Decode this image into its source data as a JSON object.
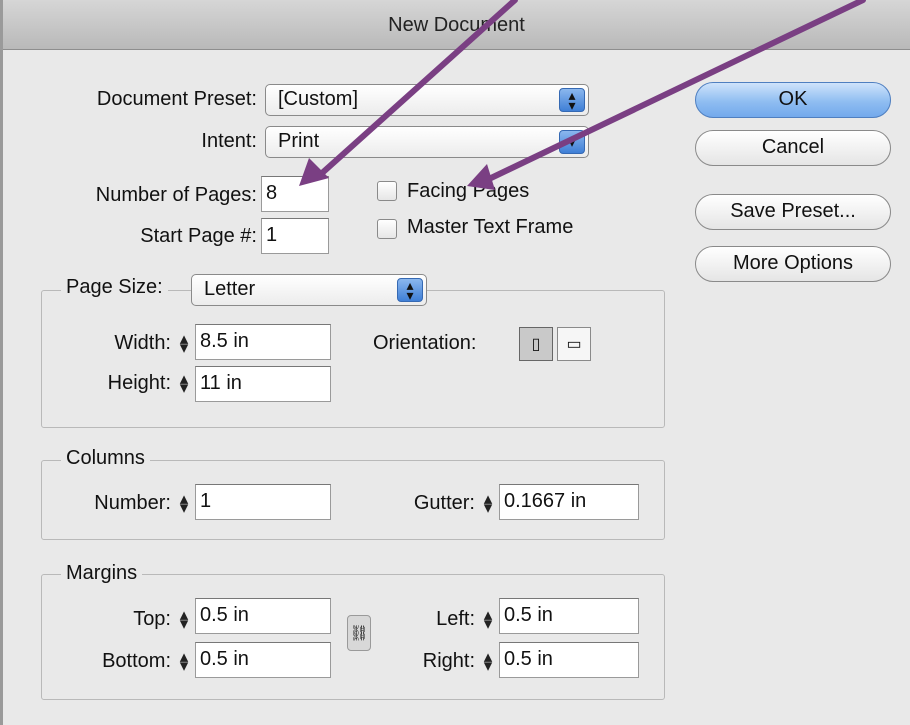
{
  "window": {
    "title": "New Document"
  },
  "top": {
    "preset_label": "Document Preset:",
    "preset_value": "[Custom]",
    "intent_label": "Intent:",
    "intent_value": "Print",
    "pages_label": "Number of Pages:",
    "pages_value": "8",
    "start_label": "Start Page #:",
    "start_value": "1",
    "facing_label": "Facing Pages",
    "master_label": "Master Text Frame"
  },
  "buttons": {
    "ok": "OK",
    "cancel": "Cancel",
    "save_preset": "Save Preset...",
    "more_options": "More Options"
  },
  "page_size": {
    "label": "Page Size:",
    "value": "Letter",
    "width_label": "Width:",
    "width_value": "8.5 in",
    "height_label": "Height:",
    "height_value": "11 in",
    "orientation_label": "Orientation:"
  },
  "columns": {
    "title": "Columns",
    "number_label": "Number:",
    "number_value": "1",
    "gutter_label": "Gutter:",
    "gutter_value": "0.1667 in"
  },
  "margins": {
    "title": "Margins",
    "top_label": "Top:",
    "top_value": "0.5 in",
    "bottom_label": "Bottom:",
    "bottom_value": "0.5 in",
    "left_label": "Left:",
    "left_value": "0.5 in",
    "right_label": "Right:",
    "right_value": "0.5 in"
  },
  "colors": {
    "annotation_arrow": "#7a3f83",
    "default_button": "#8fbdf1"
  }
}
